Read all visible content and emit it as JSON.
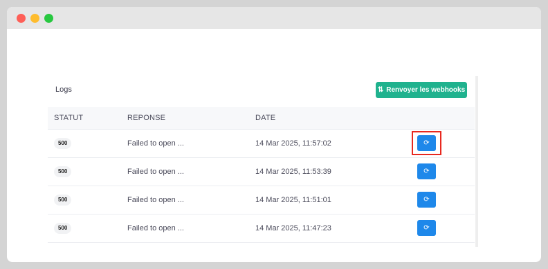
{
  "card": {
    "title": "Logs",
    "resend_label": "Renvoyer les webhooks",
    "resend_icon": "refresh-icon"
  },
  "table": {
    "columns": [
      "STATUT",
      "REPONSE",
      "DATE",
      ""
    ],
    "rows": [
      {
        "status": "500",
        "response": "Failed to open ...",
        "date": "14 Mar 2025, 11:57:02",
        "action_icon": "refresh-icon"
      },
      {
        "status": "500",
        "response": "Failed to open ...",
        "date": "14 Mar 2025, 11:53:39",
        "action_icon": "refresh-icon"
      },
      {
        "status": "500",
        "response": "Failed to open ...",
        "date": "14 Mar 2025, 11:51:01",
        "action_icon": "refresh-icon"
      },
      {
        "status": "500",
        "response": "Failed to open ...",
        "date": "14 Mar 2025, 11:47:23",
        "action_icon": "refresh-icon"
      }
    ]
  },
  "colors": {
    "resend_button": "#20b28e",
    "retry_button": "#1e88ea",
    "highlight": "#e8281f"
  }
}
